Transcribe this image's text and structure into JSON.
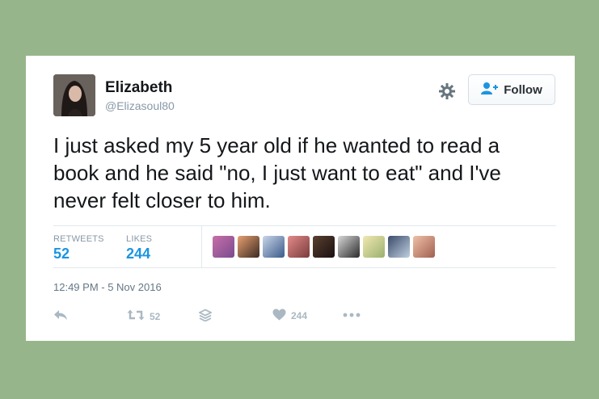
{
  "tweet": {
    "name": "Elizabeth",
    "handle": "@Elizasoul80",
    "text_lines": [
      "I just asked my 5 year old if he wanted to read a",
      "book and he said \"no, I just want to eat\" and I've",
      "never felt closer to him."
    ],
    "timestamp": "12:49 PM - 5 Nov 2016"
  },
  "header": {
    "follow_label": "Follow"
  },
  "stats": {
    "retweets_label": "RETWEETS",
    "retweets_count": "52",
    "likes_label": "LIKES",
    "likes_count": "244"
  },
  "actions": {
    "retweet_count": "52",
    "like_count": "244"
  },
  "colors": {
    "background": "#97b58a",
    "accent": "#1b95e0",
    "icon_gray": "#aab8c2"
  },
  "icons": [
    "gear-icon",
    "follow-person-icon",
    "reply-icon",
    "retweet-icon",
    "stack-icon",
    "heart-icon",
    "more-icon"
  ]
}
